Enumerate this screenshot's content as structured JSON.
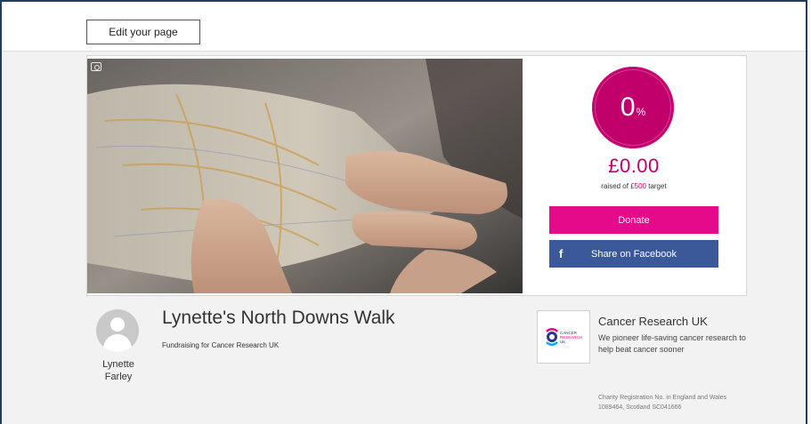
{
  "toolbar": {
    "edit_label": "Edit your page"
  },
  "progress": {
    "percent_value": "0",
    "percent_sign": "%",
    "fraction": 0
  },
  "fundraising": {
    "raised_amount": "£0.00",
    "raised_prefix": "raised of ",
    "target_amount": "£500",
    "raised_suffix": " target"
  },
  "actions": {
    "donate_label": "Donate",
    "facebook_icon": "f",
    "facebook_label": "Share on Facebook"
  },
  "page": {
    "title": "Lynette's North Downs Walk",
    "subtitle": "Fundraising for Cancer Research UK",
    "owner_first": "Lynette",
    "owner_last": "Farley"
  },
  "charity": {
    "name": "Cancer Research UK",
    "description": "We pioneer life-saving cancer research to help beat cancer sooner",
    "registration": "Charity Registration No. in England and Wales 1089464, Scotland SC041666",
    "logo_text": "CANCER RESEARCH UK"
  },
  "icons": {
    "camera": "camera-icon",
    "facebook": "facebook-icon",
    "avatar": "user-avatar-icon"
  },
  "colors": {
    "accent": "#e40a8a",
    "progress": "#c2006b",
    "facebook": "#3b5998"
  }
}
